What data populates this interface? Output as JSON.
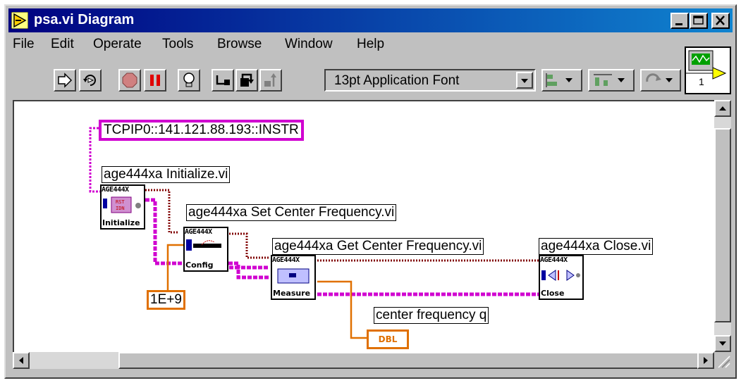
{
  "window": {
    "title": "psa.vi Diagram"
  },
  "menu": {
    "items": [
      "File",
      "Edit",
      "Operate",
      "Tools",
      "Browse",
      "Window",
      "Help"
    ]
  },
  "toolbar": {
    "font_selector_value": "13pt Application Font",
    "connector_pane_number": "1"
  },
  "diagram": {
    "resource_string": "TCPIP0::141.121.88.193::INSTR",
    "frequency_constant": "1E+9",
    "indicator_label": "center frequency q",
    "indicator_type": "DBL",
    "nodes": [
      {
        "label": "age444xa Initialize.vi",
        "header": "AGE444X",
        "name": "Initialize"
      },
      {
        "label": "age444xa Set Center Frequency.vi",
        "header": "AGE444X",
        "name": "Config"
      },
      {
        "label": "age444xa Get Center Frequency.vi",
        "header": "AGE444X",
        "name": "Measure"
      },
      {
        "label": "age444xa Close.vi",
        "header": "AGE444X",
        "name": "Close"
      }
    ]
  },
  "colors": {
    "title_bar": "#000080",
    "string_wire": "#d000d0",
    "numeric_wire": "#e07000",
    "error_wire": "#800000"
  }
}
